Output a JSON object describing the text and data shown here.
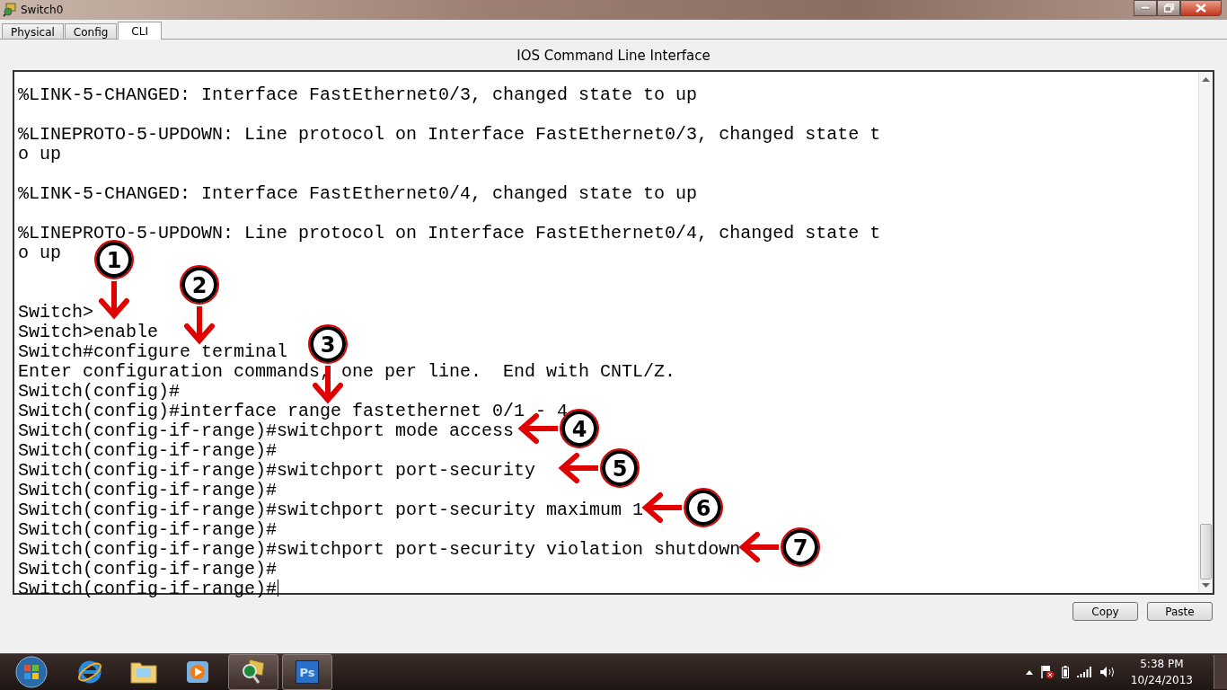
{
  "window": {
    "title": "Switch0"
  },
  "tabs": [
    {
      "label": "Physical",
      "selected": false
    },
    {
      "label": "Config",
      "selected": false
    },
    {
      "label": "CLI",
      "selected": true
    }
  ],
  "panel_title": "IOS Command Line Interface",
  "terminal": {
    "blocks": [
      {
        "kind": "message",
        "lines": [
          "%LINK-5-CHANGED: Interface FastEthernet0/3, changed state to up"
        ]
      },
      {
        "kind": "message",
        "lines": [
          "%LINEPROTO-5-UPDOWN: Line protocol on Interface FastEthernet0/3, changed state t",
          "o up"
        ]
      },
      {
        "kind": "message",
        "lines": [
          "%LINK-5-CHANGED: Interface FastEthernet0/4, changed state to up"
        ]
      },
      {
        "kind": "message",
        "lines": [
          "%LINEPROTO-5-UPDOWN: Line protocol on Interface FastEthernet0/4, changed state t",
          "o up"
        ]
      },
      {
        "kind": "session",
        "lines": [
          "Switch>",
          "Switch>enable",
          "Switch#configure terminal",
          "Enter configuration commands, one per line.  End with CNTL/Z.",
          "Switch(config)#",
          "Switch(config)#interface range fastethernet 0/1 - 4",
          "Switch(config-if-range)#switchport mode access",
          "Switch(config-if-range)#",
          "Switch(config-if-range)#switchport port-security",
          "Switch(config-if-range)#",
          "Switch(config-if-range)#switchport port-security maximum 1",
          "Switch(config-if-range)#",
          "Switch(config-if-range)#switchport port-security violation shutdown",
          "Switch(config-if-range)#",
          "Switch(config-if-range)#"
        ]
      }
    ]
  },
  "callouts": [
    {
      "number": "1",
      "kind": "down"
    },
    {
      "number": "2",
      "kind": "down"
    },
    {
      "number": "3",
      "kind": "down"
    },
    {
      "number": "4",
      "kind": "left"
    },
    {
      "number": "5",
      "kind": "left"
    },
    {
      "number": "6",
      "kind": "left"
    },
    {
      "number": "7",
      "kind": "left"
    }
  ],
  "buttons": [
    "Copy",
    "Paste"
  ],
  "taskbar": {
    "photoshop_label": "Ps",
    "clock": {
      "time": "5:38 PM",
      "date": "10/24/2013"
    }
  }
}
